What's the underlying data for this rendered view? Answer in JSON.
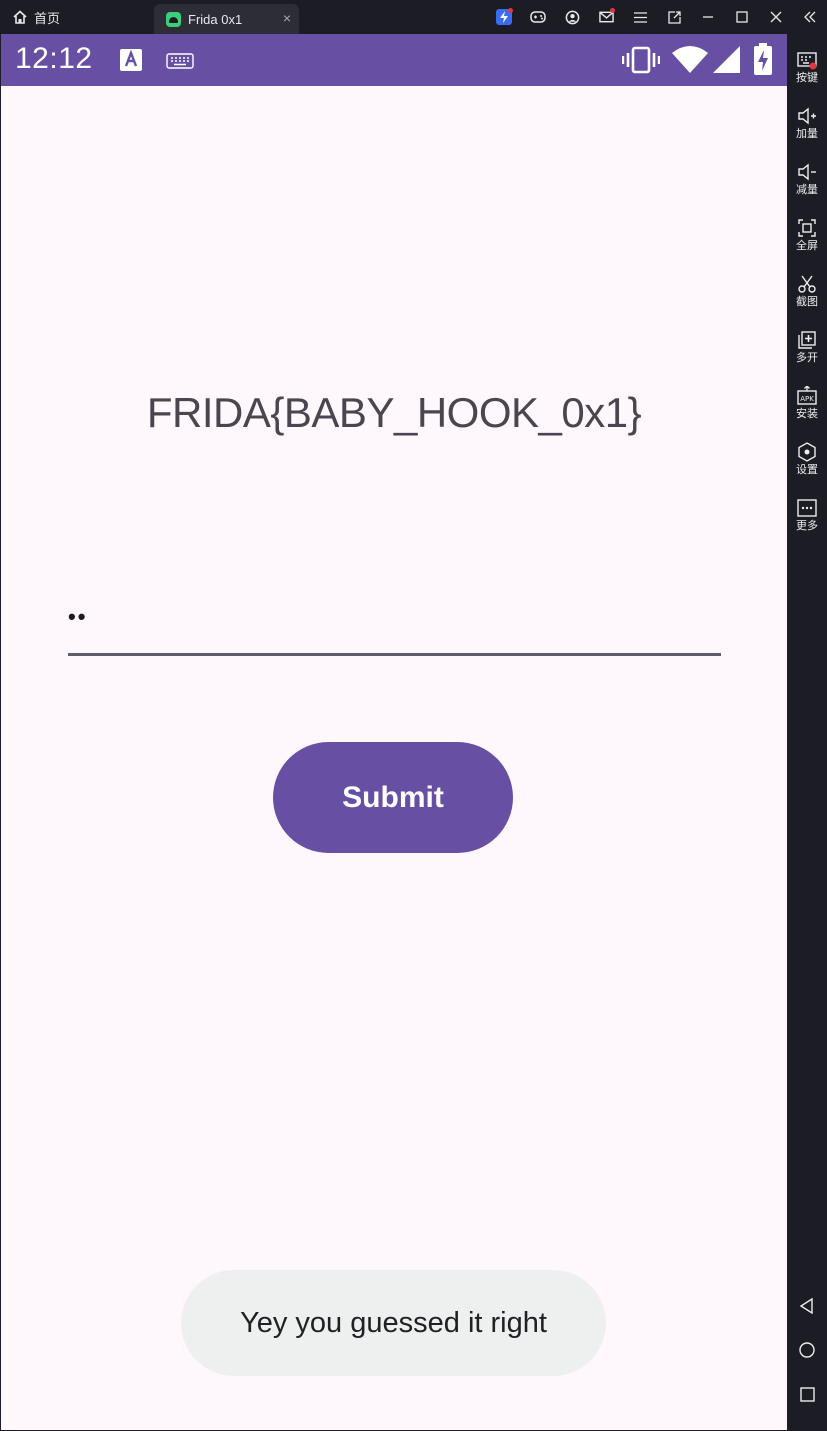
{
  "titlebar": {
    "home_label": "首页",
    "home_icon": "home-icon",
    "tab_title": "Frida 0x1",
    "tab_icon": "android-icon",
    "close_tab_glyph": "×",
    "controls": [
      "lightning-icon",
      "gamepad-icon",
      "account-icon",
      "mail-icon",
      "menu-icon",
      "export-icon",
      "minimize-icon",
      "maximize-icon",
      "close-icon",
      "collapse-icon"
    ]
  },
  "statusbar": {
    "time": "12:12",
    "bg_color": "#6750a4",
    "icons": [
      "text-a-icon",
      "keyboard-icon",
      "vibrate-icon",
      "wifi-icon",
      "signal-icon",
      "battery-charging-icon"
    ]
  },
  "main": {
    "flag_text": "FRIDA{BABY_HOOK_0x1}",
    "password_value": "••",
    "submit_label": "Submit",
    "accent_color": "#6750a4"
  },
  "toast": {
    "message": "Yey you guessed it right"
  },
  "sidebar": {
    "items": [
      {
        "label": "按键",
        "icon": "keyboard-map-icon"
      },
      {
        "label": "加量",
        "icon": "volume-up-icon"
      },
      {
        "label": "减量",
        "icon": "volume-down-icon"
      },
      {
        "label": "全屏",
        "icon": "fullscreen-icon"
      },
      {
        "label": "截图",
        "icon": "scissors-icon"
      },
      {
        "label": "多开",
        "icon": "multi-instance-icon"
      },
      {
        "label": "安装",
        "icon": "apk-icon"
      },
      {
        "label": "设置",
        "icon": "settings-icon"
      },
      {
        "label": "更多",
        "icon": "more-icon"
      }
    ],
    "nav": [
      "back-icon",
      "home-circle-icon",
      "recents-icon"
    ]
  }
}
